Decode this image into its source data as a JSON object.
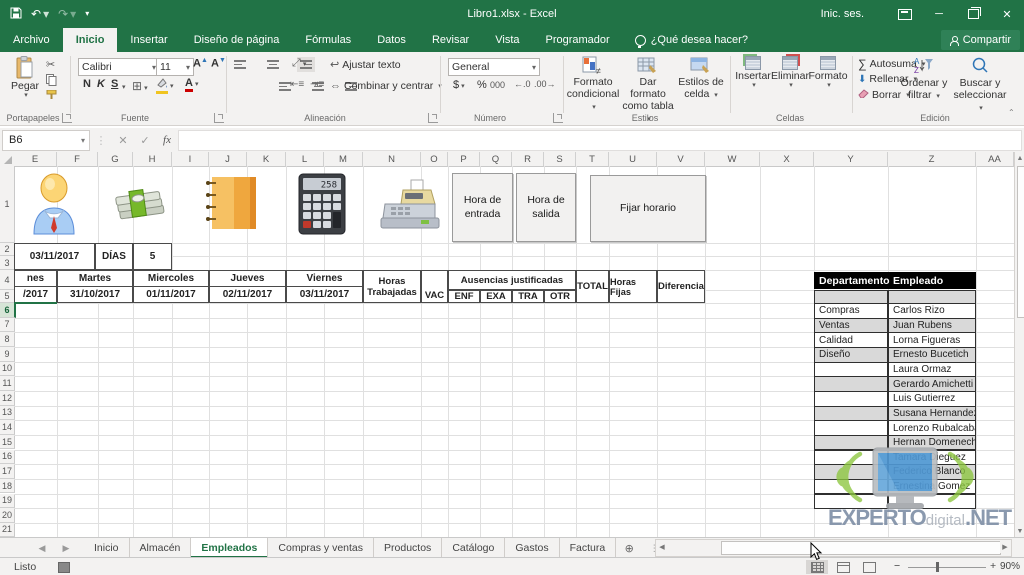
{
  "window": {
    "title": "Libro1.xlsx  -  Excel",
    "signin": "Inic. ses.",
    "minimize": "─",
    "close": "✕"
  },
  "menu": {
    "tabs": [
      {
        "label": "Archivo",
        "active": false
      },
      {
        "label": "Inicio",
        "active": true
      },
      {
        "label": "Insertar",
        "active": false
      },
      {
        "label": "Diseño de página",
        "active": false
      },
      {
        "label": "Fórmulas",
        "active": false
      },
      {
        "label": "Datos",
        "active": false
      },
      {
        "label": "Revisar",
        "active": false
      },
      {
        "label": "Vista",
        "active": false
      },
      {
        "label": "Programador",
        "active": false
      }
    ],
    "tellme": "¿Qué desea hacer?",
    "share": "Compartir"
  },
  "ribbon": {
    "portapapeles": {
      "label": "Portapapeles",
      "paste": "Pegar"
    },
    "fuente": {
      "label": "Fuente",
      "font_name": "Calibri",
      "font_size": "11",
      "bold": "N",
      "italic": "K",
      "underline": "S"
    },
    "alineacion": {
      "label": "Alineación",
      "wrap": "Ajustar texto",
      "merge": "Combinar y centrar"
    },
    "numero": {
      "label": "Número",
      "format": "General",
      "currency": "$",
      "percent": "%",
      "thousands": "000"
    },
    "estilos": {
      "label": "Estilos",
      "cond1": "Formato",
      "cond2": "condicional",
      "tbl1": "Dar formato",
      "tbl2": "como tabla",
      "cell1": "Estilos de",
      "cell2": "celda"
    },
    "celdas": {
      "label": "Celdas",
      "insert": "Insertar",
      "remove": "Eliminar",
      "format": "Formato"
    },
    "edicion": {
      "label": "Edición",
      "autosum": "Autosuma",
      "fill": "Rellenar",
      "clear": "Borrar",
      "sort1": "Ordenar y",
      "sort2": "filtrar",
      "find1": "Buscar y",
      "find2": "seleccionar"
    }
  },
  "formula_bar": {
    "name_box": "B6",
    "fx": "fx"
  },
  "grid": {
    "columns": [
      "E",
      "F",
      "G",
      "H",
      "I",
      "J",
      "K",
      "L",
      "M",
      "N",
      "O",
      "P",
      "Q",
      "R",
      "S",
      "T",
      "U",
      "V",
      "W",
      "X",
      "Y",
      "Z",
      "AA"
    ],
    "rows": [
      "1",
      "2",
      "3",
      "4",
      "5",
      "6",
      "7",
      "8",
      "9",
      "10",
      "11",
      "12",
      "13",
      "14",
      "15",
      "16",
      "17",
      "18",
      "19",
      "20",
      "21"
    ],
    "selected_row": "6"
  },
  "sheet": {
    "icons": [
      "person-icon",
      "money-icon",
      "notebook-icon",
      "calculator-icon",
      "cash-register-icon"
    ],
    "info_cells": {
      "date": "03/11/2017",
      "dias_label": "DÍAS",
      "dias_value": "5"
    },
    "form_buttons": [
      {
        "label": "Hora de entrada"
      },
      {
        "label": "Hora de salida"
      },
      {
        "label": "Fijar horario"
      }
    ],
    "timesheet": {
      "days": [
        {
          "day": "nes",
          "date": "/2017"
        },
        {
          "day": "Martes",
          "date": "31/10/2017"
        },
        {
          "day": "Miercoles",
          "date": "01/11/2017"
        },
        {
          "day": "Jueves",
          "date": "02/11/2017"
        },
        {
          "day": "Viernes",
          "date": "03/11/2017"
        }
      ],
      "horas1": "Horas",
      "horas2": "Trabajadas",
      "vac": "VAC",
      "ausencias": "Ausencias justificadas",
      "ausencia_codes": [
        "ENF",
        "EXA",
        "TRA",
        "OTR"
      ],
      "total": "TOTAL",
      "horas_fijas": "Horas Fijas",
      "diferencia": "Diferencia"
    }
  },
  "employees": {
    "headers": [
      "Departamento",
      "Empleado"
    ],
    "rows": [
      {
        "dept": "",
        "name": ""
      },
      {
        "dept": "Compras",
        "name": "Carlos Rizo"
      },
      {
        "dept": "Ventas",
        "name": "Juan Rubens"
      },
      {
        "dept": "Calidad",
        "name": "Lorna Figueras"
      },
      {
        "dept": "Diseño",
        "name": "Ernesto Bucetich"
      },
      {
        "dept": "",
        "name": "Laura Ormaz"
      },
      {
        "dept": "",
        "name": "Gerardo Amichetti"
      },
      {
        "dept": "",
        "name": "Luis Gutierrez"
      },
      {
        "dept": "",
        "name": "Susana Hernandez"
      },
      {
        "dept": "",
        "name": "Lorenzo Rubalcaba"
      },
      {
        "dept": "",
        "name": "Hernan Domenech"
      },
      {
        "dept": "",
        "name": "Tamara Dieguez"
      },
      {
        "dept": "",
        "name": "Federico Blanco"
      },
      {
        "dept": "",
        "name": "Ernestina Gomez"
      },
      {
        "dept": "",
        "name": ""
      }
    ]
  },
  "watermark": {
    "part1": "EXPERTO",
    "part2": "digital",
    "part3": ".NET"
  },
  "sheet_tabs": {
    "tabs": [
      {
        "label": "Inicio",
        "active": false
      },
      {
        "label": "Almacén",
        "active": false
      },
      {
        "label": "Empleados",
        "active": true
      },
      {
        "label": "Compras y ventas",
        "active": false
      },
      {
        "label": "Productos",
        "active": false
      },
      {
        "label": "Catálogo",
        "active": false
      },
      {
        "label": "Gastos",
        "active": false
      },
      {
        "label": "Factura",
        "active": false
      }
    ]
  },
  "status_bar": {
    "mode": "Listo",
    "zoom": "90%"
  }
}
